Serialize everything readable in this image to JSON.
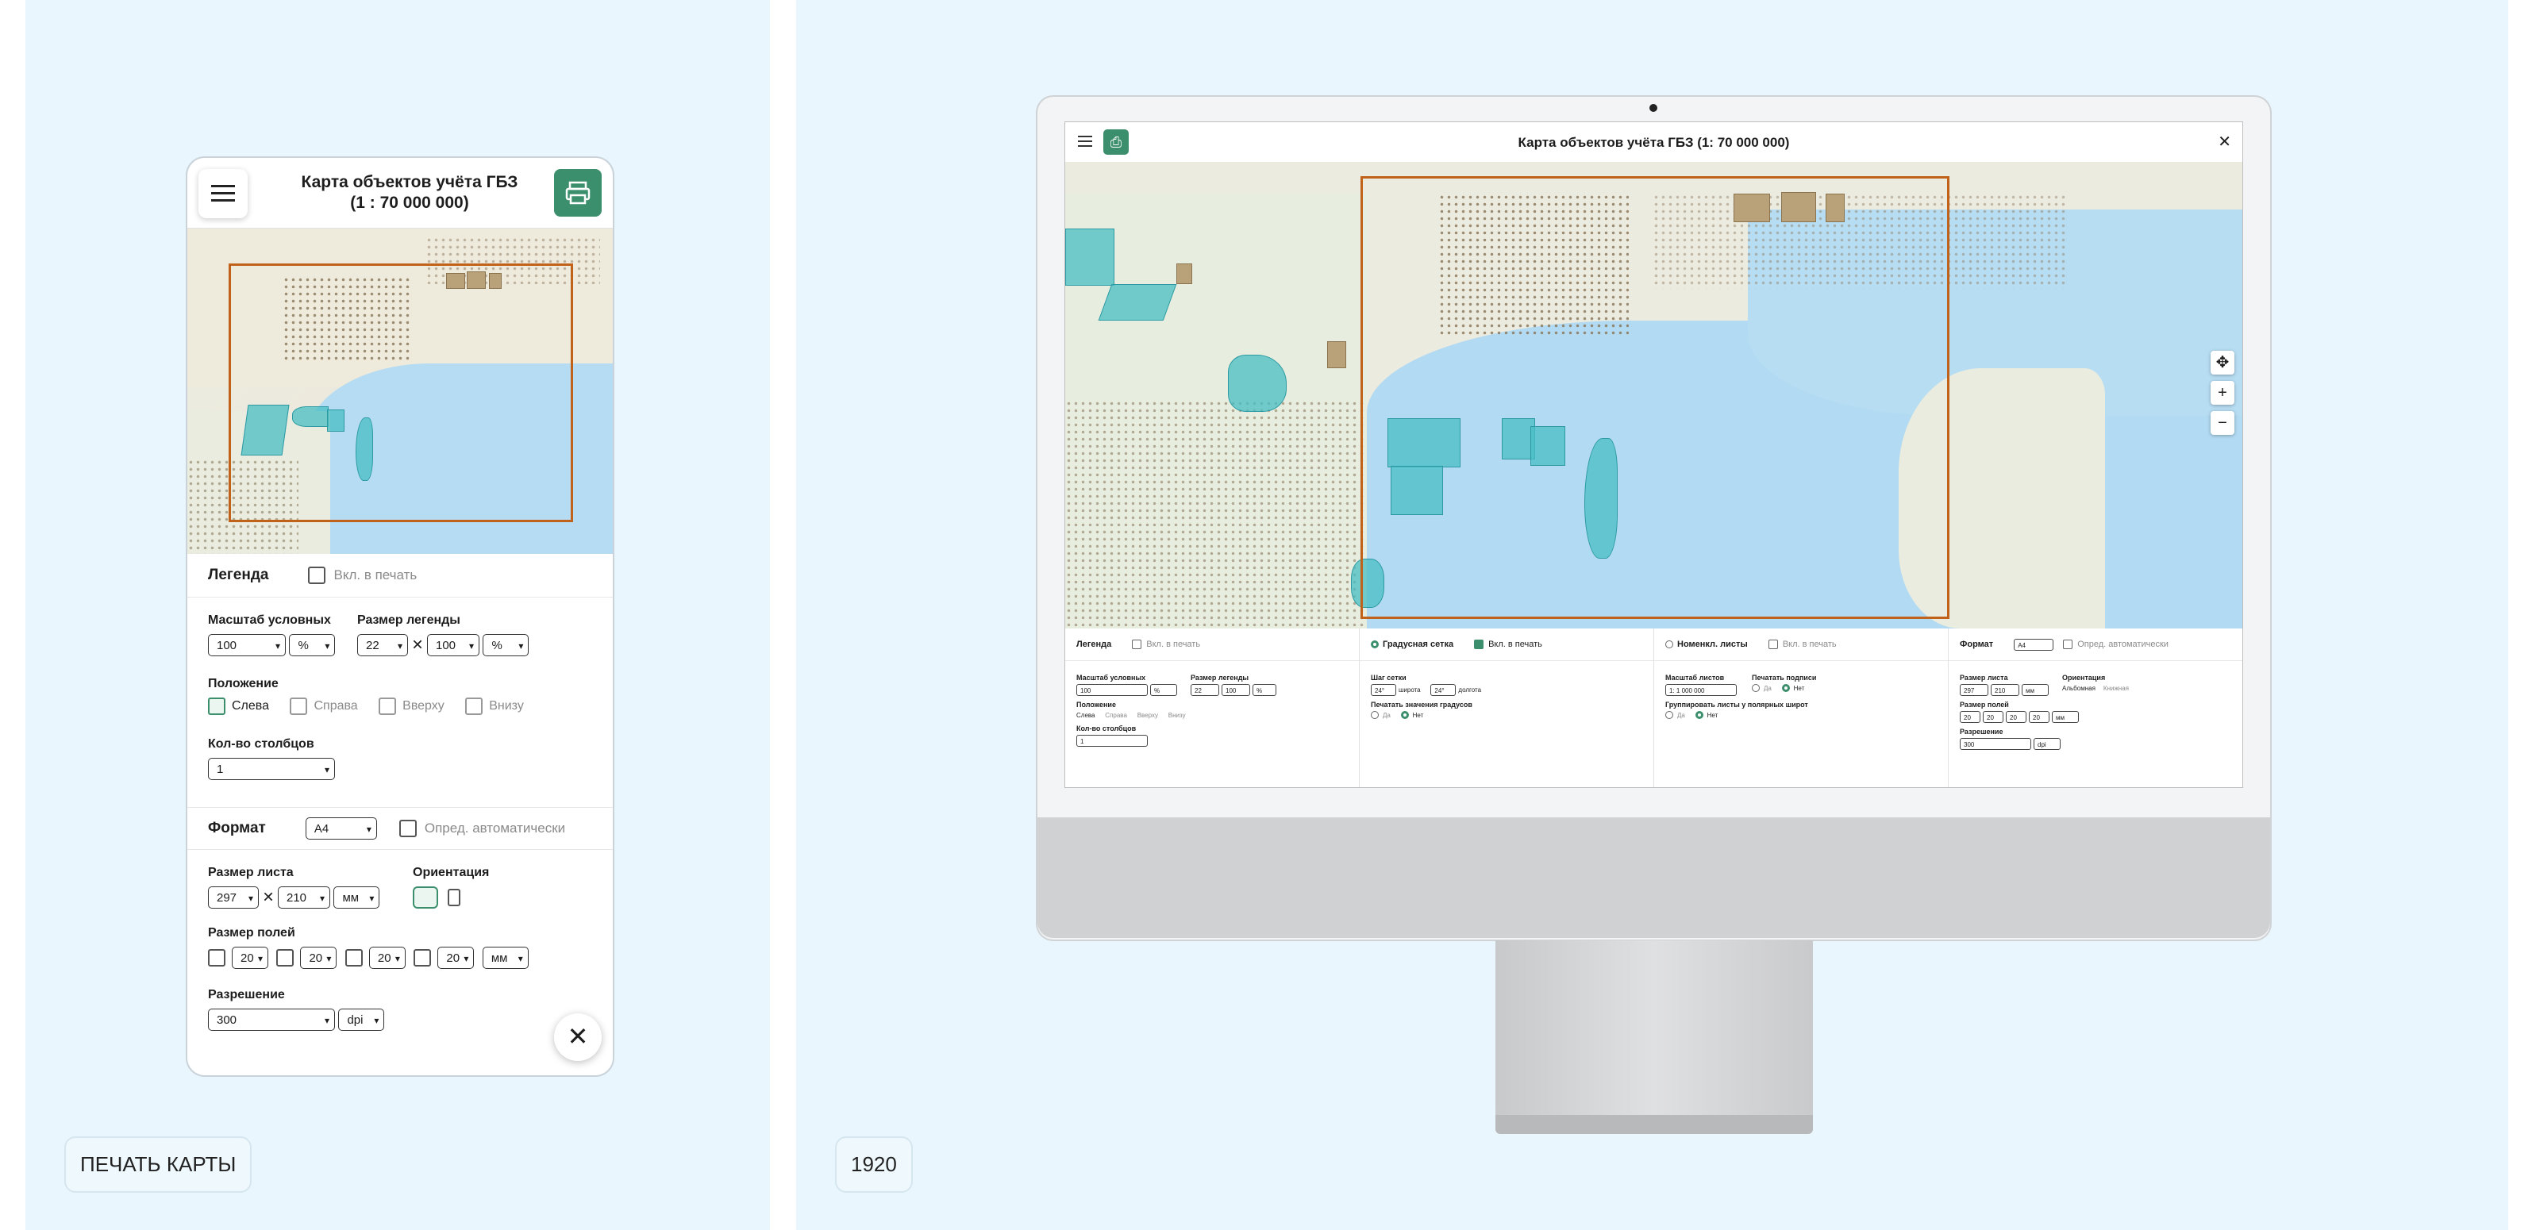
{
  "left": {
    "chip_label": "ПЕЧАТЬ КАРТЫ",
    "header": {
      "title_line1": "Карта объектов учёта ГБЗ",
      "title_line2": "(1 : 70 000 000)"
    },
    "legend": {
      "title": "Легенда",
      "include_in_print": "Вкл. в печать",
      "scale_label": "Масштаб условных",
      "scale_value": "100",
      "scale_unit": "%",
      "size_label": "Размер легенды",
      "size_w": "22",
      "size_h": "100",
      "size_unit": "%",
      "position_label": "Положение",
      "positions": [
        "Слева",
        "Справа",
        "Вверху",
        "Внизу"
      ],
      "columns_label": "Кол-во столбцов",
      "columns_value": "1"
    },
    "format": {
      "title": "Формат",
      "value": "A4",
      "auto": "Опред. автоматически",
      "sheet_label": "Размер листа",
      "sheet_w": "297",
      "sheet_h": "210",
      "sheet_unit": "мм",
      "orientation_label": "Ориентация",
      "margins_label": "Размер полей",
      "margins": [
        "20",
        "20",
        "20",
        "20"
      ],
      "margins_unit": "мм",
      "resolution_label": "Разрешение",
      "resolution_value": "300",
      "resolution_unit": "dpi"
    },
    "close_glyph": "✕"
  },
  "right": {
    "chip_label": "1920",
    "screen": {
      "title": "Карта объектов учёта ГБЗ (1: 70 000 000)",
      "close_glyph": "✕",
      "zoom": [
        "✥",
        "+",
        "−"
      ]
    },
    "legend_col": {
      "title": "Легенда",
      "print": "Вкл. в печать",
      "scale_label": "Масштаб условных",
      "scale_value": "100",
      "scale_unit": "%",
      "size_label": "Размер легенды",
      "size_w": "22",
      "size_h": "100",
      "size_unit": "%",
      "position_label": "Положение",
      "positions": [
        "Слева",
        "Справа",
        "Вверху",
        "Внизу"
      ],
      "columns_label": "Кол-во столбцов",
      "columns_value": "1"
    },
    "grid_col": {
      "title": "Градусная сетка",
      "print": "Вкл. в печать",
      "step_label": "Шаг сетки",
      "lat_value": "24°",
      "lat_label": "широта",
      "lon_value": "24°",
      "lon_label": "долгота",
      "degrees_label": "Печатать значения градусов",
      "yes": "Да",
      "no": "Нет"
    },
    "sheets_col": {
      "title": "Номенкл. листы",
      "print": "Вкл. в печать",
      "scale_label": "Масштаб листов",
      "scale_value": "1: 1 000 000",
      "caption_label": "Печатать подписи",
      "yes": "Да",
      "no": "Нет",
      "group_label": "Группировать листы у полярных широт",
      "group_yes": "Да",
      "group_no": "Нет"
    },
    "format_col": {
      "title": "Формат",
      "value": "A4",
      "auto": "Опред. автоматически",
      "sheet_label": "Размер листа",
      "sheet_w": "297",
      "sheet_h": "210",
      "sheet_unit": "мм",
      "orientation_label": "Ориентация",
      "landscape": "Альбомная",
      "portrait": "Книжная",
      "margins_label": "Размер полей",
      "margins": [
        "20",
        "20",
        "20",
        "20"
      ],
      "margins_unit": "мм",
      "resolution_label": "Разрешение",
      "resolution_value": "300",
      "resolution_unit": "dpi"
    }
  }
}
